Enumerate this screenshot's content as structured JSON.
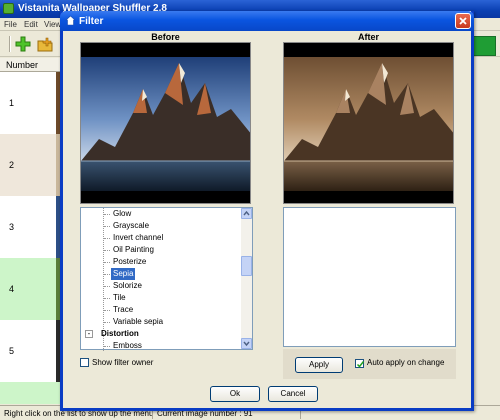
{
  "app": {
    "title": "Vistanita Wallpaper Shuffler 2.8",
    "menu": [
      "File",
      "Edit",
      "View"
    ],
    "list": {
      "column_header": "Number",
      "rows": [
        "1",
        "2",
        "3",
        "4",
        "5"
      ]
    },
    "status": {
      "hint": "Right click on the list to show up the menu",
      "current_image": "Current image number : 91"
    },
    "colors": {
      "titlebar": "#0a3fb2",
      "highlight_row": "#cdf5c9",
      "beige_row": "#efe7db"
    }
  },
  "dialog": {
    "title": "Filter",
    "before_label": "Before",
    "after_label": "After",
    "filter_list": [
      {
        "label": "Glow",
        "type": "item"
      },
      {
        "label": "Grayscale",
        "type": "item"
      },
      {
        "label": "Invert channel",
        "type": "item"
      },
      {
        "label": "Oil Painting",
        "type": "item"
      },
      {
        "label": "Posterize",
        "type": "item"
      },
      {
        "label": "Sepia",
        "type": "item",
        "selected": true
      },
      {
        "label": "Solorize",
        "type": "item"
      },
      {
        "label": "Tile",
        "type": "item"
      },
      {
        "label": "Trace",
        "type": "item"
      },
      {
        "label": "Variable sepia",
        "type": "item"
      },
      {
        "label": "Distortion",
        "type": "category",
        "toggle": "-"
      },
      {
        "label": "Emboss",
        "type": "item"
      }
    ],
    "apply_label": "Apply",
    "auto_apply_label": "Auto apply on change",
    "auto_apply_checked": true,
    "show_owner_label": "Show filter owner",
    "show_owner_checked": false,
    "ok_label": "Ok",
    "cancel_label": "Cancel"
  }
}
